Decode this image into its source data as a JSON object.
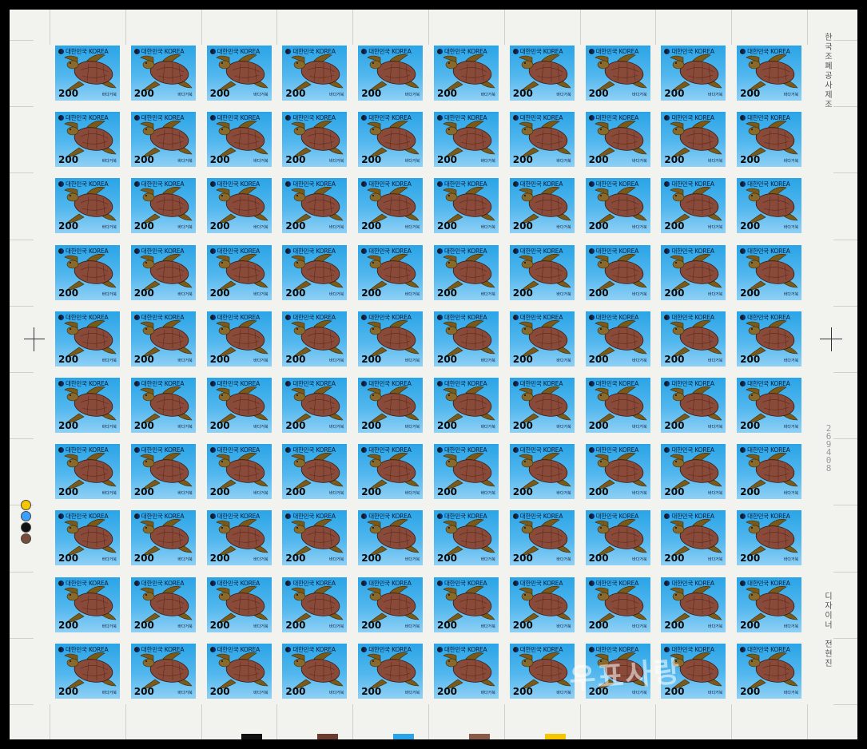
{
  "stamp": {
    "title": "대한민국 KOREA",
    "value": "200",
    "name": "바다거북",
    "icon": "sea-turtle-icon"
  },
  "rows": 10,
  "cols": 10,
  "margin": {
    "printer_vertical": "한국조폐공사제조",
    "designer_vertical": "디자이너 전현진",
    "serial": "269408",
    "watermark": "우표사랑"
  },
  "colors": {
    "stamp_blue": "#2aa4e6",
    "turtle_shell": "#8a4a3a",
    "turtle_skin": "#7a5a1a",
    "plate_colors": [
      "#f5c700",
      "#3aa0ff",
      "#111111",
      "#7a4a3a"
    ],
    "color_bars": [
      "#111111",
      "#6b3c2f",
      "#2aa4e6",
      "#8b5b4a",
      "#f5c700"
    ]
  }
}
